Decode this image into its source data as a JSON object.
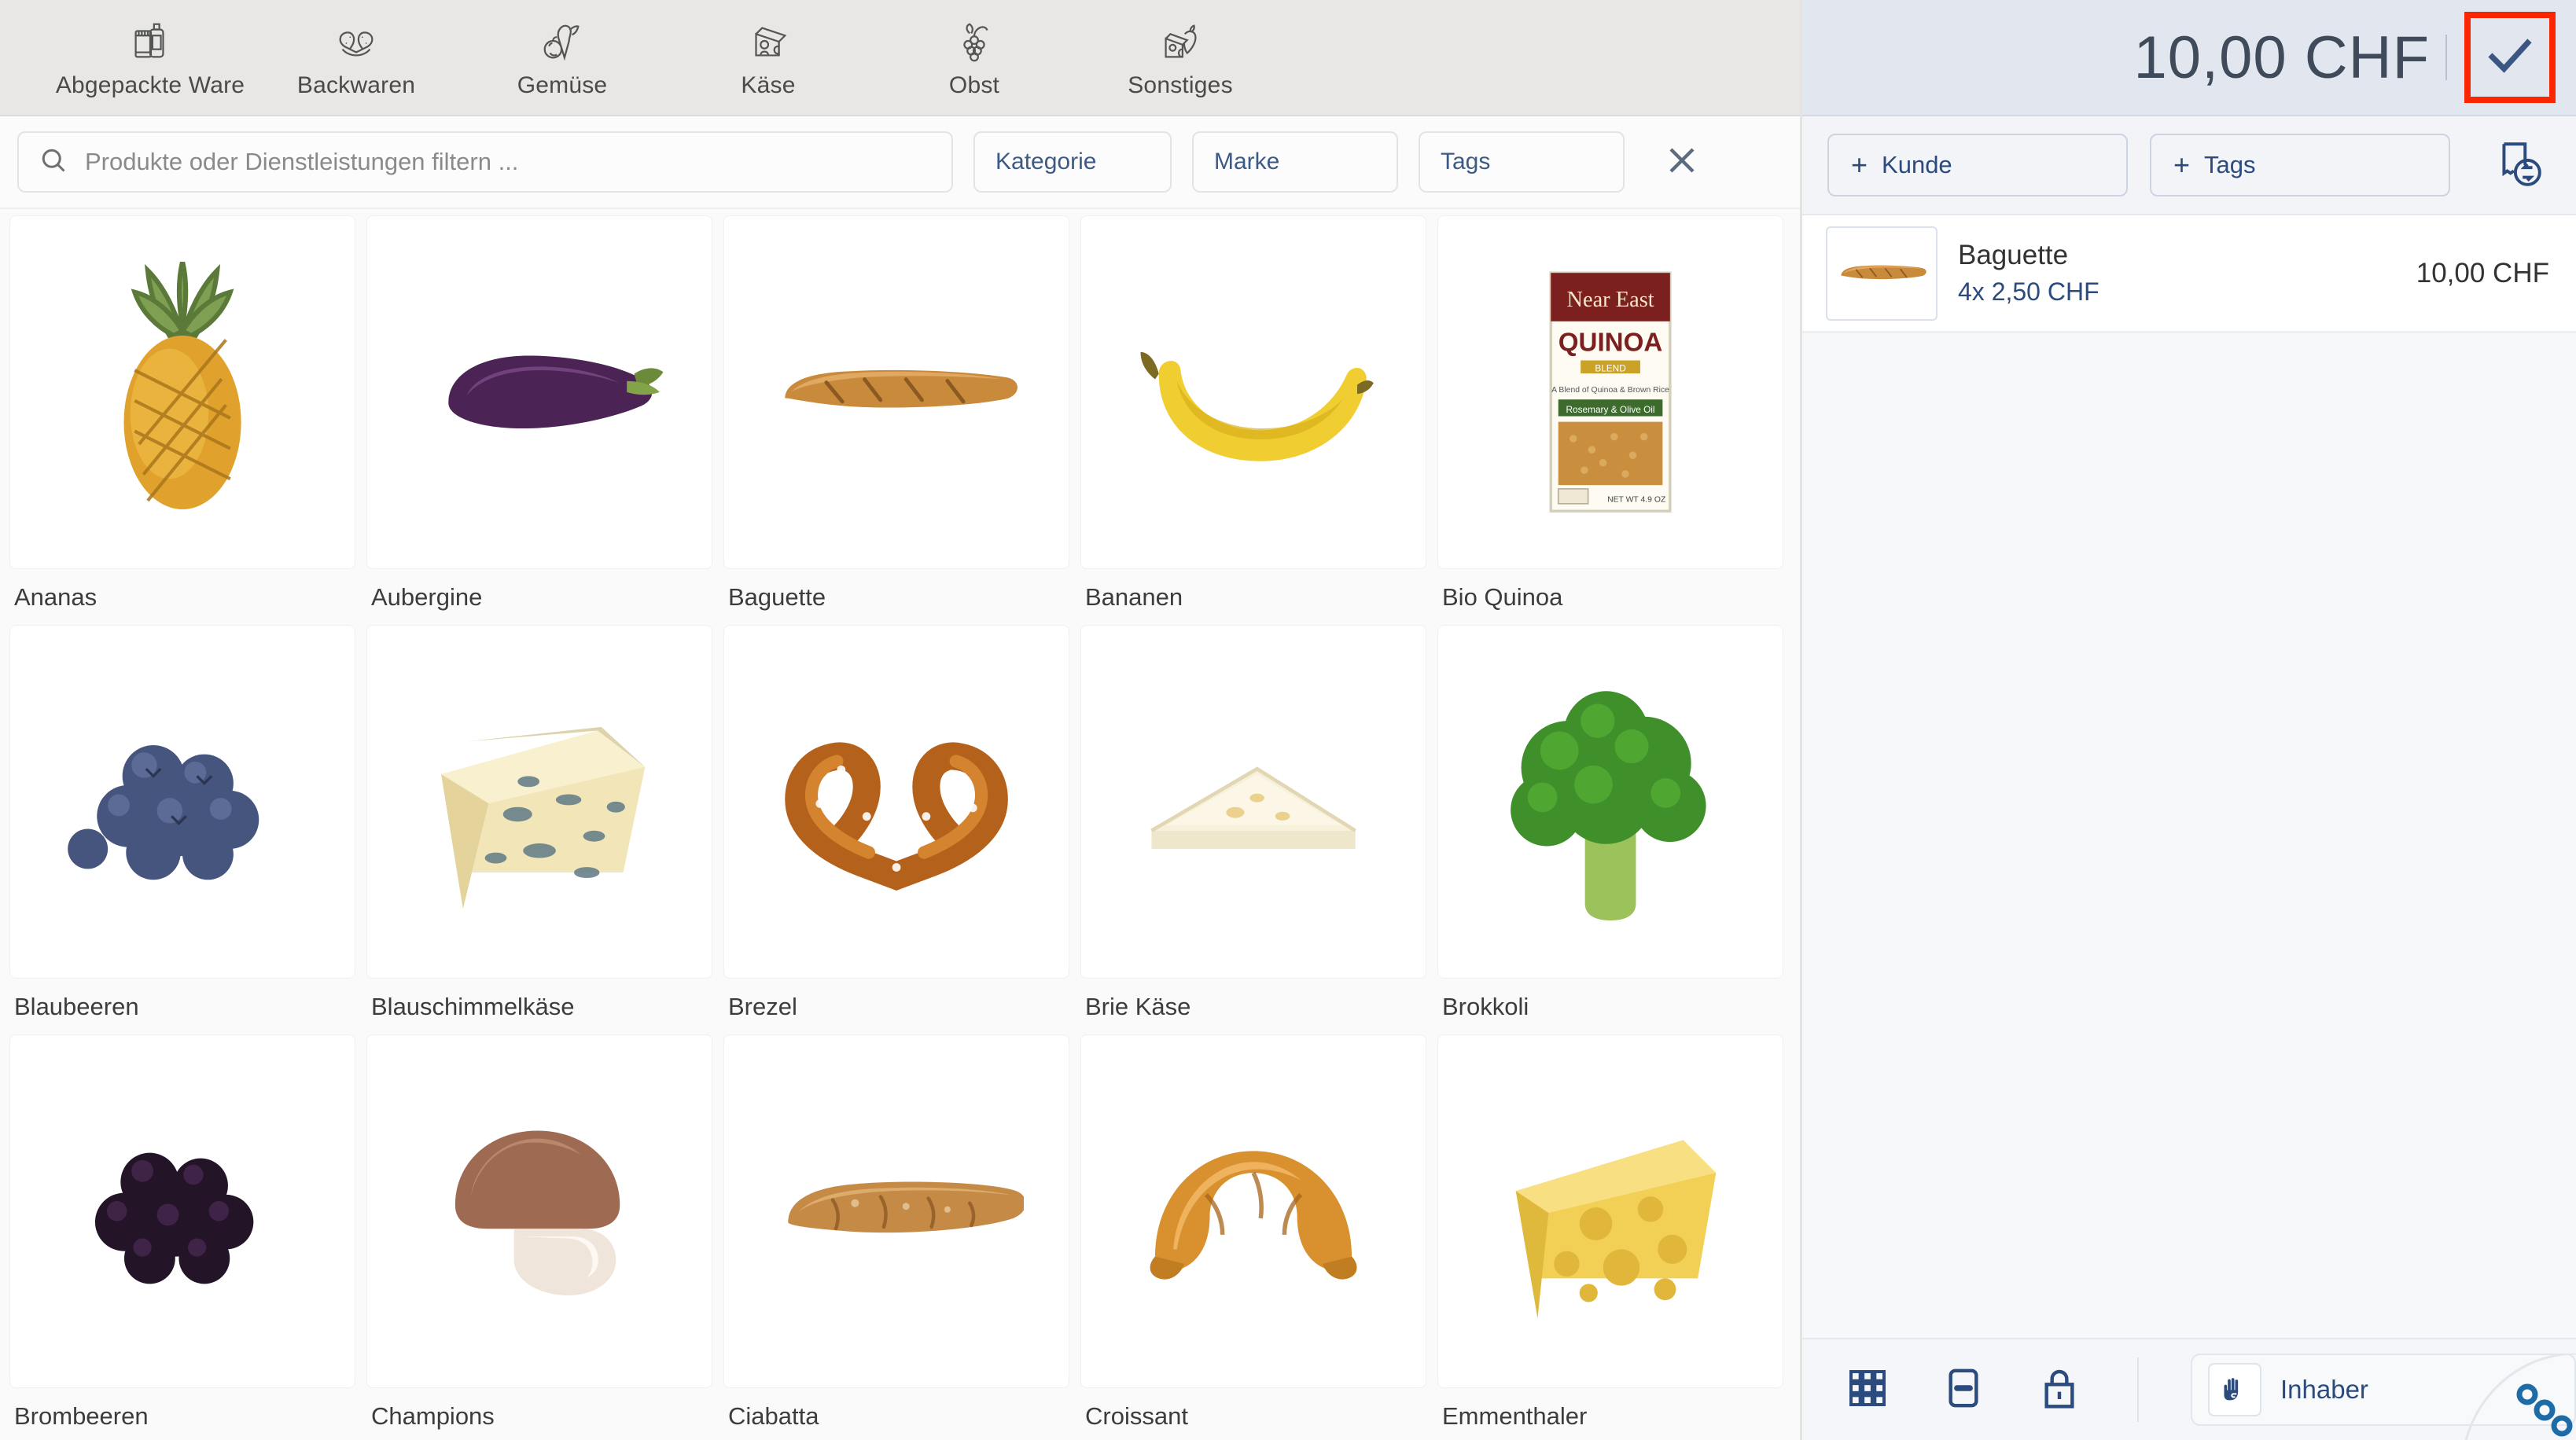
{
  "categories": [
    {
      "label": "Abgepackte Ware",
      "icon": "packaged-goods-icon"
    },
    {
      "label": "Backwaren",
      "icon": "pretzel-icon"
    },
    {
      "label": "Gemüse",
      "icon": "vegetables-icon"
    },
    {
      "label": "Käse",
      "icon": "cheese-icon"
    },
    {
      "label": "Obst",
      "icon": "grapes-icon"
    },
    {
      "label": "Sonstiges",
      "icon": "misc-food-icon"
    }
  ],
  "filter_bar": {
    "search_placeholder": "Produkte oder Dienstleistungen filtern  ...",
    "search_value": "",
    "chips": [
      "Kategorie",
      "Marke",
      "Tags"
    ],
    "clear_icon": "close-icon"
  },
  "products": [
    {
      "name": "Ananas",
      "image": "pineapple"
    },
    {
      "name": "Aubergine",
      "image": "eggplant"
    },
    {
      "name": "Baguette",
      "image": "baguette"
    },
    {
      "name": "Bananen",
      "image": "banana"
    },
    {
      "name": "Bio Quinoa",
      "image": "quinoa-box"
    },
    {
      "name": "Blaubeeren",
      "image": "blueberries"
    },
    {
      "name": "Blauschimmelkäse",
      "image": "blue-cheese"
    },
    {
      "name": "Brezel",
      "image": "pretzel"
    },
    {
      "name": "Brie Käse",
      "image": "brie"
    },
    {
      "name": "Brokkoli",
      "image": "broccoli"
    },
    {
      "name": "Brombeeren",
      "image": "blackberries"
    },
    {
      "name": "Champions",
      "image": "mushroom"
    },
    {
      "name": "Ciabatta",
      "image": "ciabatta"
    },
    {
      "name": "Croissant",
      "image": "croissant"
    },
    {
      "name": "Emmenthaler",
      "image": "emmental"
    }
  ],
  "cart": {
    "total": "10,00 CHF",
    "confirm_icon": "checkmark-icon",
    "confirm_highlighted": true,
    "actions": {
      "add_customer": "Kunde",
      "add_tags": "Tags",
      "plus": "+",
      "receipt_icon": "receipt-return-icon"
    },
    "items": [
      {
        "name": "Baguette",
        "quantity_price": "4x 2,50 CHF",
        "line_total": "10,00 CHF",
        "image": "baguette"
      }
    ],
    "footer": {
      "keypad_icon": "keypad-grid-icon",
      "minus_icon": "minus-box-icon",
      "lock_icon": "lock-icon",
      "user_icon": "hand-icon",
      "user_name": "Inhaber"
    }
  },
  "colors": {
    "toolbar_bg": "#e8e7e5",
    "cart_header_bg": "#e2e6ee",
    "accent_blue": "#2b4a7d",
    "annotation_red": "#fa2600",
    "text_dark": "#3c3c3c"
  }
}
